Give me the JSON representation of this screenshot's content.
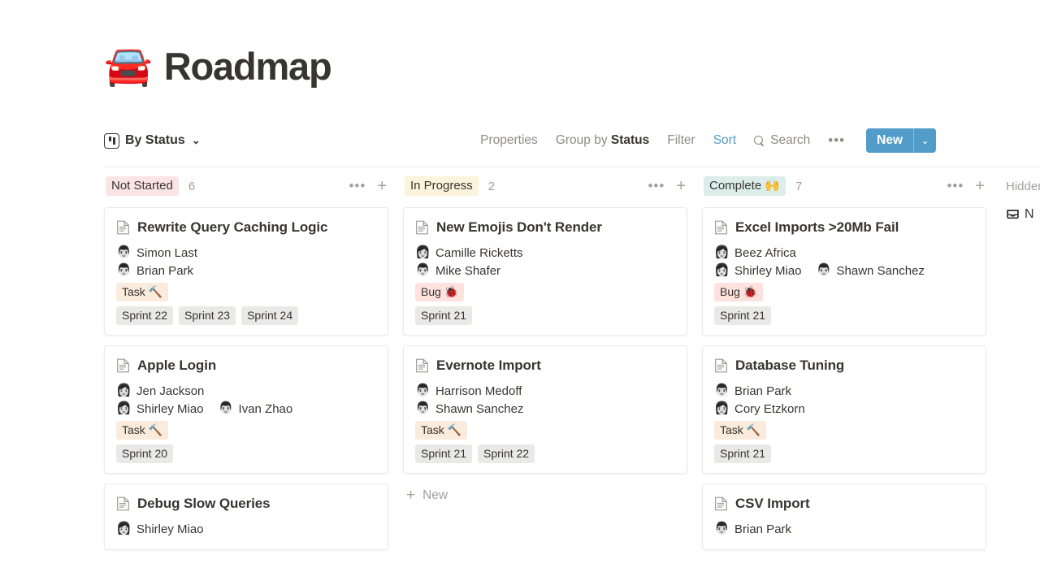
{
  "header": {
    "emoji": "🚘",
    "emoji_icon_name": "car-emoji",
    "title": "Roadmap"
  },
  "toolbar": {
    "view_name": "By Status",
    "view_icon": "board-view-icon",
    "view_chevron": "⌄",
    "properties_label": "Properties",
    "group_by_prefix": "Group by ",
    "group_by_value": "Status",
    "filter_label": "Filter",
    "sort_label": "Sort",
    "search_label": "Search",
    "search_icon": "search-icon",
    "more_label": "•••",
    "new_label": "New",
    "new_caret": "⌄",
    "accent_color": "#529cca"
  },
  "board": {
    "columns": [
      {
        "name": "Not Started",
        "chip_color": "#fbe4e4",
        "count": "6",
        "dots": "•••",
        "plus": "+",
        "cards": [
          {
            "title": "Rewrite Query Caching Logic",
            "icon": "document-icon",
            "people_rows": [
              [
                {
                  "avatar": "👨",
                  "name": "Simon Last"
                }
              ],
              [
                {
                  "avatar": "👨",
                  "name": "Brian Park"
                }
              ]
            ],
            "type_tag": {
              "label": "Task 🔨",
              "color": "#faebdd"
            },
            "sprints": [
              "Sprint 22",
              "Sprint 23",
              "Sprint 24"
            ]
          },
          {
            "title": "Apple Login",
            "icon": "document-icon",
            "people_rows": [
              [
                {
                  "avatar": "👩",
                  "name": "Jen Jackson"
                }
              ],
              [
                {
                  "avatar": "👩",
                  "name": "Shirley Miao"
                },
                {
                  "avatar": "👨",
                  "name": "Ivan Zhao"
                }
              ]
            ],
            "type_tag": {
              "label": "Task 🔨",
              "color": "#faebdd"
            },
            "sprints": [
              "Sprint 20"
            ]
          },
          {
            "title": "Debug Slow Queries",
            "icon": "document-icon",
            "people_rows": [
              [
                {
                  "avatar": "👩",
                  "name": "Shirley Miao"
                }
              ]
            ],
            "type_tag": null,
            "sprints": []
          }
        ]
      },
      {
        "name": "In Progress",
        "chip_color": "#fbf3db",
        "count": "2",
        "dots": "•••",
        "plus": "+",
        "cards": [
          {
            "title": "New Emojis Don't Render",
            "icon": "document-icon",
            "people_rows": [
              [
                {
                  "avatar": "👩",
                  "name": "Camille Ricketts"
                }
              ],
              [
                {
                  "avatar": "👨",
                  "name": "Mike Shafer"
                }
              ]
            ],
            "type_tag": {
              "label": "Bug 🐞",
              "color": "#ffe2dd"
            },
            "sprints": [
              "Sprint 21"
            ]
          },
          {
            "title": "Evernote Import",
            "icon": "document-icon",
            "people_rows": [
              [
                {
                  "avatar": "👨",
                  "name": "Harrison Medoff"
                }
              ],
              [
                {
                  "avatar": "👨",
                  "name": "Shawn Sanchez"
                }
              ]
            ],
            "type_tag": {
              "label": "Task 🔨",
              "color": "#faebdd"
            },
            "sprints": [
              "Sprint 21",
              "Sprint 22"
            ]
          }
        ],
        "new_row": {
          "label": "New",
          "plus": "+"
        }
      },
      {
        "name": "Complete 🙌",
        "chip_color": "#ddedea",
        "count": "7",
        "dots": "•••",
        "plus": "+",
        "cards": [
          {
            "title": "Excel Imports >20Mb Fail",
            "icon": "document-icon",
            "people_rows": [
              [
                {
                  "avatar": "👩",
                  "name": "Beez Africa"
                }
              ],
              [
                {
                  "avatar": "👩",
                  "name": "Shirley Miao"
                },
                {
                  "avatar": "👨",
                  "name": "Shawn Sanchez"
                }
              ]
            ],
            "type_tag": {
              "label": "Bug 🐞",
              "color": "#ffe2dd"
            },
            "sprints": [
              "Sprint 21"
            ]
          },
          {
            "title": "Database Tuning",
            "icon": "document-icon",
            "people_rows": [
              [
                {
                  "avatar": "👨",
                  "name": "Brian Park"
                }
              ],
              [
                {
                  "avatar": "👩",
                  "name": "Cory Etzkorn"
                }
              ]
            ],
            "type_tag": {
              "label": "Task 🔨",
              "color": "#faebdd"
            },
            "sprints": [
              "Sprint 21"
            ]
          },
          {
            "title": "CSV Import",
            "icon": "document-icon",
            "people_rows": [
              [
                {
                  "avatar": "👨",
                  "name": "Brian Park"
                }
              ]
            ],
            "type_tag": null,
            "sprints": []
          }
        ]
      }
    ],
    "hidden_group": {
      "label": "Hidden",
      "item_label": "N",
      "item_icon": "inbox-icon"
    }
  }
}
